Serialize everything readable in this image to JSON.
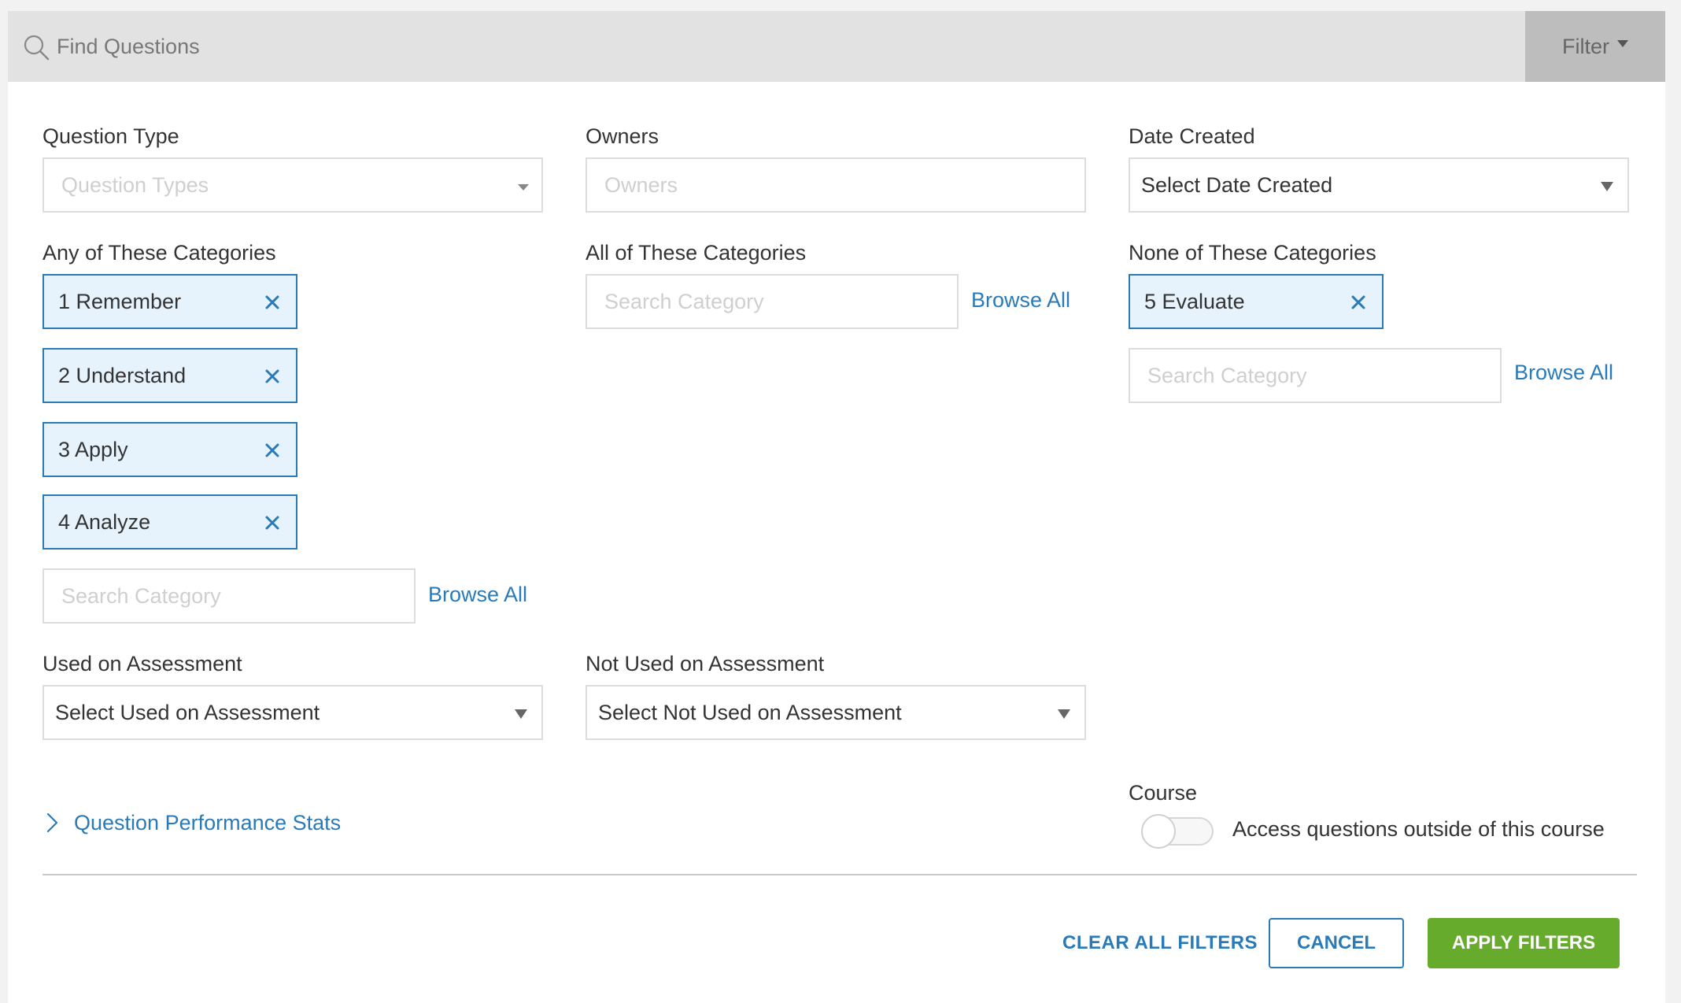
{
  "search": {
    "placeholder": "Find Questions",
    "filter_label": "Filter"
  },
  "question_type": {
    "label": "Question Type",
    "placeholder": "Question Types"
  },
  "owners": {
    "label": "Owners",
    "placeholder": "Owners"
  },
  "date_created": {
    "label": "Date Created",
    "value": "Select Date Created"
  },
  "any_categories": {
    "label": "Any of These Categories",
    "chips": [
      "1 Remember",
      "2 Understand",
      "3 Apply",
      "4 Analyze"
    ],
    "search_placeholder": "Search Category",
    "browse_label": "Browse All"
  },
  "all_categories": {
    "label": "All of These Categories",
    "search_placeholder": "Search Category",
    "browse_label": "Browse All"
  },
  "none_categories": {
    "label": "None of These Categories",
    "chips": [
      "5 Evaluate"
    ],
    "search_placeholder": "Search Category",
    "browse_label": "Browse All"
  },
  "used_on_assessment": {
    "label": "Used on Assessment",
    "value": "Select Used on Assessment"
  },
  "not_used_on_assessment": {
    "label": "Not Used on Assessment",
    "value": "Select Not Used on Assessment"
  },
  "performance_stats": {
    "label": "Question Performance Stats"
  },
  "course": {
    "label": "Course",
    "toggle_label": "Access questions outside of this course",
    "toggle_on": false
  },
  "actions": {
    "clear_label": "CLEAR ALL FILTERS",
    "cancel_label": "CANCEL",
    "apply_label": "APPLY FILTERS"
  },
  "colors": {
    "accent": "#2a7ab8",
    "chip_bg": "#e6f3fc",
    "apply_bg": "#67ab2d",
    "searchbar_bg": "#e2e2e2",
    "filter_bg": "#bdbdbd"
  }
}
